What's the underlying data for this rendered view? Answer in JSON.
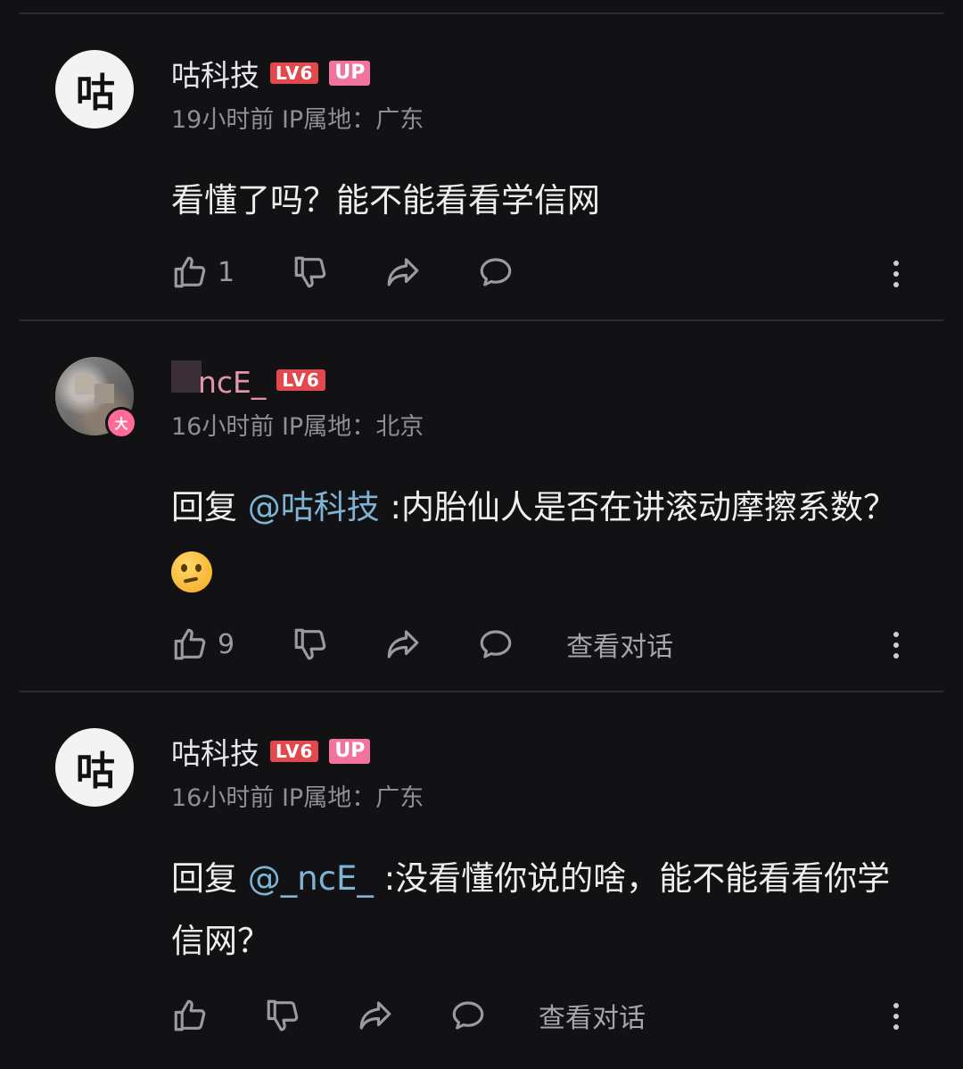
{
  "comments": [
    {
      "author": "咕科技",
      "avatar_text": "咕",
      "level": "LV6",
      "badge": "UP",
      "time": "19小时前",
      "ip_location": "IP属地：广东",
      "text": "看懂了吗？能不能看看学信网",
      "like_count": "1",
      "view_thread": ""
    },
    {
      "author": "ncE_",
      "avatar_badge": "大",
      "level": "LV6",
      "time": "16小时前",
      "ip_location": "IP属地：北京",
      "reply_prefix": "回复 ",
      "mention": "@咕科技",
      "text": " :内胎仙人是否在讲滚动摩擦系数？",
      "like_count": "9",
      "view_thread": "查看对话"
    },
    {
      "author": "咕科技",
      "avatar_text": "咕",
      "level": "LV6",
      "badge": "UP",
      "time": "16小时前",
      "ip_location": "IP属地：广东",
      "reply_prefix": "回复 ",
      "mention": "@_ncE_",
      "text": " :没看懂你说的啥，能不能看看你学信网？",
      "like_count": "",
      "view_thread": "查看对话"
    }
  ],
  "icons": [
    "thumbs-up-icon",
    "thumbs-down-icon",
    "share-icon",
    "reply-bubble-icon",
    "more-vertical-icon"
  ],
  "colors": {
    "background": "#121214",
    "level_badge": "#e2484e",
    "up_badge": "#f0749b",
    "mention": "#7fb3d6"
  }
}
